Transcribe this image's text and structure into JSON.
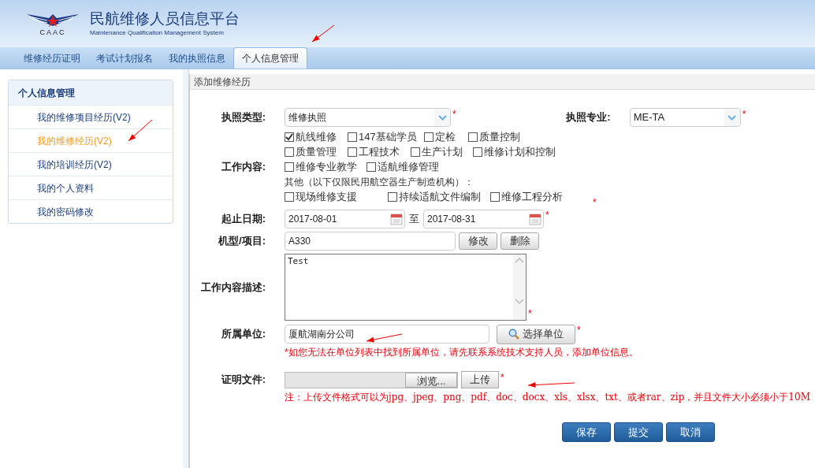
{
  "header": {
    "logo_text": "CAAC",
    "title": "民航维修人员信息平台",
    "subtitle": "Maintenance Qualification Management System"
  },
  "nav_tabs": [
    {
      "label": "维修经历证明",
      "selected": false
    },
    {
      "label": "考试计划报名",
      "selected": false
    },
    {
      "label": "我的执照信息",
      "selected": false
    },
    {
      "label": "个人信息管理",
      "selected": true
    }
  ],
  "sidebar": {
    "heading": "个人信息管理",
    "items": [
      {
        "label": "我的维修项目经历(V2)",
        "selected": false
      },
      {
        "label": "我的维修经历(V2)",
        "selected": true
      },
      {
        "label": "我的培训经历(V2)",
        "selected": false
      },
      {
        "label": "我的个人资料",
        "selected": false
      },
      {
        "label": "我的密码修改",
        "selected": false
      }
    ]
  },
  "panel": {
    "title": "添加维修经历"
  },
  "form": {
    "license_type": {
      "label": "执照类型:",
      "value": "维修执照",
      "required": "*"
    },
    "license_specialty": {
      "label": "执照专业:",
      "value": "ME-TA",
      "required": "*"
    },
    "work_content": {
      "label": "工作内容:",
      "rows": [
        [
          {
            "label": "航线维修",
            "checked": true
          },
          {
            "label": "147基础学员",
            "checked": false
          },
          {
            "label": "定检",
            "checked": false
          },
          {
            "label": "质量控制",
            "checked": false
          }
        ],
        [
          {
            "label": "质量管理",
            "checked": false
          },
          {
            "label": "工程技术",
            "checked": false
          },
          {
            "label": "生产计划",
            "checked": false
          },
          {
            "label": "维修计划和控制",
            "checked": false
          }
        ],
        [
          {
            "label": "维修专业教学",
            "checked": false
          },
          {
            "label": "适航维修管理",
            "checked": false
          }
        ]
      ],
      "other_label": "其他（以下仅限民用航空器生产制造机构）：",
      "other_items": [
        {
          "label": "现场维修支援",
          "checked": false
        },
        {
          "label": "持续适航文件编制",
          "checked": false
        },
        {
          "label": "维修工程分析",
          "checked": false
        }
      ],
      "required": "*"
    },
    "dates": {
      "label": "起止日期:",
      "start": "2017-08-01",
      "separator": "至",
      "end": "2017-08-31",
      "required": "*"
    },
    "model": {
      "label": "机型/项目:",
      "value": "A330",
      "buttons": [
        "修改",
        "删除"
      ]
    },
    "description": {
      "label": "工作内容描述:",
      "value": "Test",
      "required": "*"
    },
    "unit": {
      "label": "所属单位:",
      "value": "厦航湖南分公司",
      "button": "选择单位",
      "required": "*",
      "note": "*如您无法在单位列表中找到所属单位，请先联系系统技术支持人员，添加单位信息。"
    },
    "file": {
      "label": "证明文件:",
      "browse": "浏览...",
      "upload": "上传",
      "required": "*",
      "note": "注：上传文件格式可以为jpg、jpeg、png、pdf、doc、docx、xls、xlsx、txt、或者rar、zip，并且文件大小必须小于10M"
    },
    "actions": [
      "保存",
      "提交",
      "取消"
    ]
  }
}
